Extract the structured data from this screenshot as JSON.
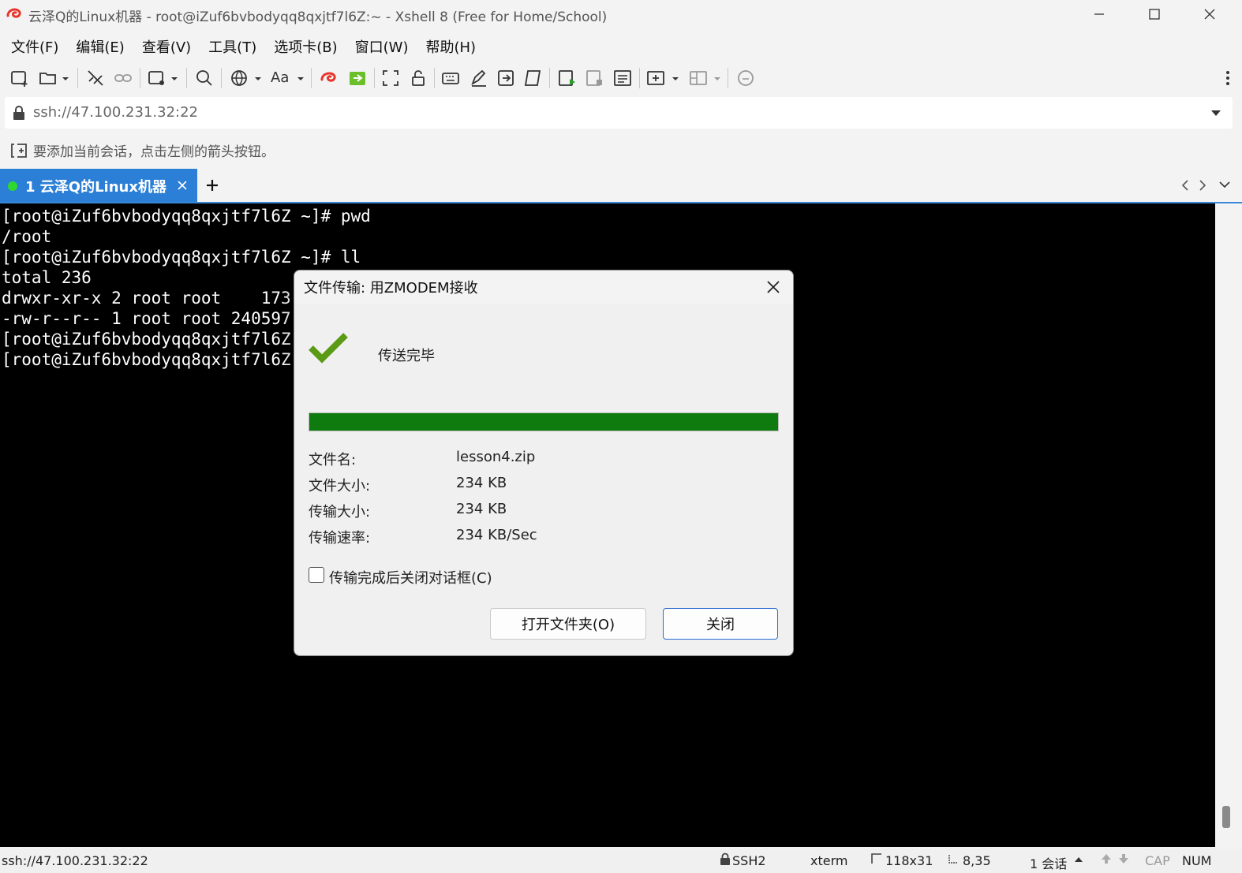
{
  "window": {
    "title": "云泽Q的Linux机器 - root@iZuf6bvbodyqq8qxjtf7l6Z:~ - Xshell 8 (Free for Home/School)"
  },
  "menu": [
    "文件(F)",
    "编辑(E)",
    "查看(V)",
    "工具(T)",
    "选项卡(B)",
    "窗口(W)",
    "帮助(H)"
  ],
  "toolbar": {
    "font_label": "Aa"
  },
  "address_bar": {
    "value": "ssh://47.100.231.32:22"
  },
  "session_hint": "要添加当前会话，点击左侧的箭头按钮。",
  "tabs": [
    {
      "label": "1 云泽Q的Linux机器",
      "connected": true
    }
  ],
  "terminal": {
    "lines": [
      "[root@iZuf6bvbodyqq8qxjtf7l6Z ~]# pwd",
      "/root",
      "[root@iZuf6bvbodyqq8qxjtf7l6Z ~]# ll",
      "total 236",
      "drwxr-xr-x 2 root root    173",
      "-rw-r--r-- 1 root root 240597",
      "[root@iZuf6bvbodyqq8qxjtf7l6Z",
      "[root@iZuf6bvbodyqq8qxjtf7l6Z"
    ]
  },
  "dialog": {
    "title": "文件传输: 用ZMODEM接收",
    "status": "传送完毕",
    "progress": 1.0,
    "fields": [
      {
        "label": "文件名:",
        "value": "lesson4.zip"
      },
      {
        "label": "文件大小:",
        "value": "234 KB"
      },
      {
        "label": "传输大小:",
        "value": "234 KB"
      },
      {
        "label": "传输速率:",
        "value": "234 KB/Sec"
      }
    ],
    "close_after_transfer_label": "传输完成后关闭对话框(C)",
    "close_after_transfer_checked": false,
    "open_folder_label": "打开文件夹(O)",
    "close_label": "关闭"
  },
  "statusbar": {
    "address": "ssh://47.100.231.32:22",
    "protocol": "SSH2",
    "terminal_type": "xterm",
    "size": "118x31",
    "cursor": "8,35",
    "sessions": "1 会话",
    "cap": "CAP",
    "num": "NUM"
  },
  "colors": {
    "accent": "#2b7fd6",
    "progress": "#0f7b0f",
    "checkmark": "#5a9a14",
    "terminal_bg": "#000000"
  }
}
